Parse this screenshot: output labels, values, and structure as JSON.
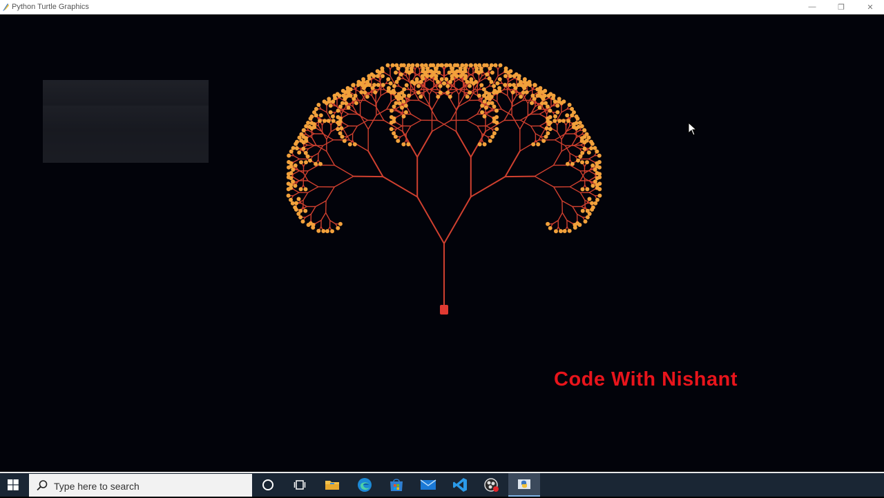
{
  "window": {
    "title": "Python Turtle Graphics",
    "minimize_glyph": "—",
    "restore_glyph": "❐",
    "close_glyph": "✕"
  },
  "canvas": {
    "background": "#02030a",
    "branch_color": "#d0402f",
    "leaf_color": "#f2a13b",
    "turtle_color": "#e03a32",
    "watermark": "Code With Nishant",
    "watermark_color": "#e8141b"
  },
  "taskbar": {
    "search_placeholder": "Type here to search",
    "icons": [
      "windows-start-icon",
      "search-icon",
      "cortana-icon",
      "task-view-icon",
      "file-explorer-icon",
      "edge-icon",
      "store-icon",
      "mail-icon",
      "vscode-icon",
      "obs-icon",
      "python-turtle-icon"
    ]
  }
}
